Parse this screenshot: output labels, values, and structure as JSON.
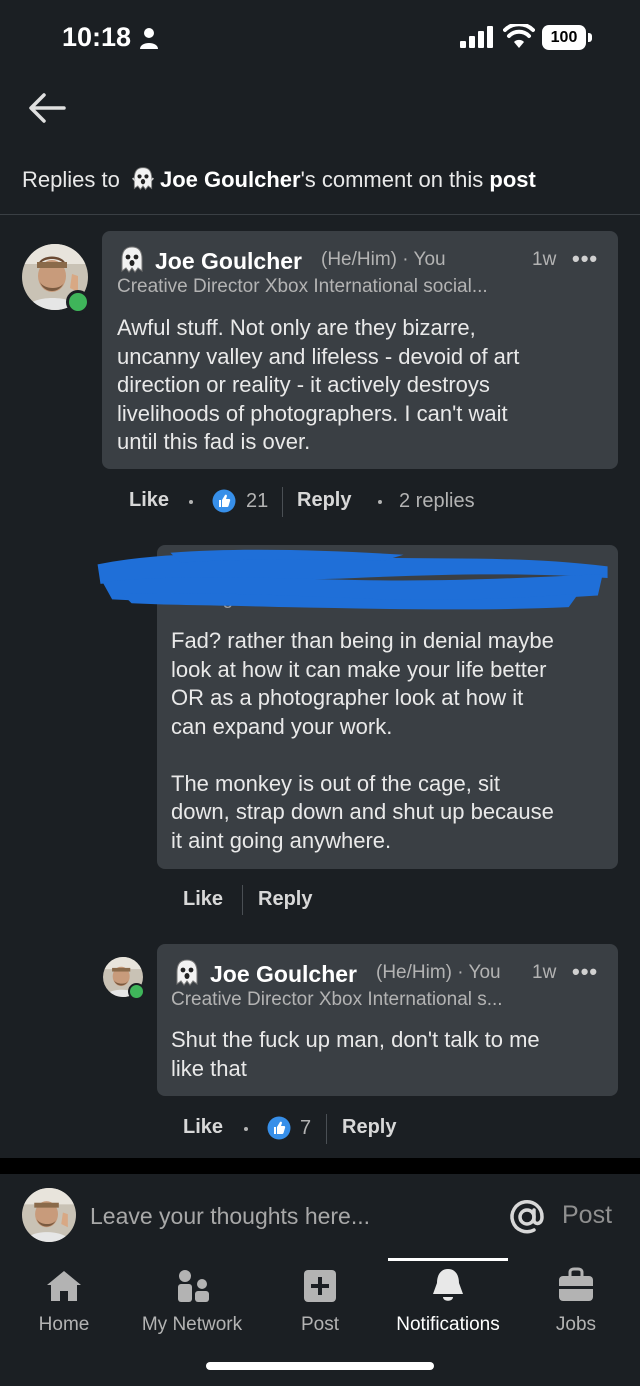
{
  "status_bar": {
    "time": "10:18",
    "battery": "100"
  },
  "header": {
    "prefix": "Replies to",
    "name": "Joe Goulcher",
    "suffix": "'s comment on this",
    "post": "post"
  },
  "comment": {
    "name": "Joe Goulcher",
    "pronouns": "(He/Him) · You",
    "time": "1w",
    "headline": "Creative Director Xbox International social...",
    "text_lines": [
      "Awful stuff. Not only are they bizarre,",
      "uncanny valley and lifeless - devoid of art",
      "direction or reality - it actively destroys",
      "livelihoods of photographers. I can't wait",
      "until this fad is over."
    ],
    "like_label": "Like",
    "reaction_count": "21",
    "reply_label": "Reply",
    "replies_count": "2 replies"
  },
  "reply1": {
    "headline_partial": "Making m...",
    "text_lines": [
      "Fad? rather than being in denial maybe",
      "look at how it can make your life better",
      "OR as a photographer look at how it",
      "can expand your work.",
      "",
      "The monkey is out of the cage, sit",
      "down, strap down and shut up because",
      "it aint going anywhere."
    ],
    "like_label": "Like",
    "reply_label": "Reply"
  },
  "reply2": {
    "name": "Joe Goulcher",
    "pronouns": "(He/Him) · You",
    "time": "1w",
    "headline": "Creative Director Xbox International s...",
    "text_lines": [
      "Shut the fuck up man, don't talk to me",
      "like that"
    ],
    "like_label": "Like",
    "reaction_count": "7",
    "reply_label": "Reply"
  },
  "composer": {
    "placeholder": "Leave your thoughts here...",
    "post_label": "Post"
  },
  "nav": {
    "items": [
      {
        "label": "Home",
        "icon": "home-icon"
      },
      {
        "label": "My Network",
        "icon": "network-icon"
      },
      {
        "label": "Post",
        "icon": "plus-box-icon"
      },
      {
        "label": "Notifications",
        "icon": "bell-icon",
        "active": true
      },
      {
        "label": "Jobs",
        "icon": "briefcase-icon"
      }
    ]
  },
  "colors": {
    "background": "#1b1f23",
    "bubble": "#3a3f44",
    "online": "#3fb55a",
    "like_blue": "#378fe9",
    "redaction": "#1f6fd8"
  }
}
